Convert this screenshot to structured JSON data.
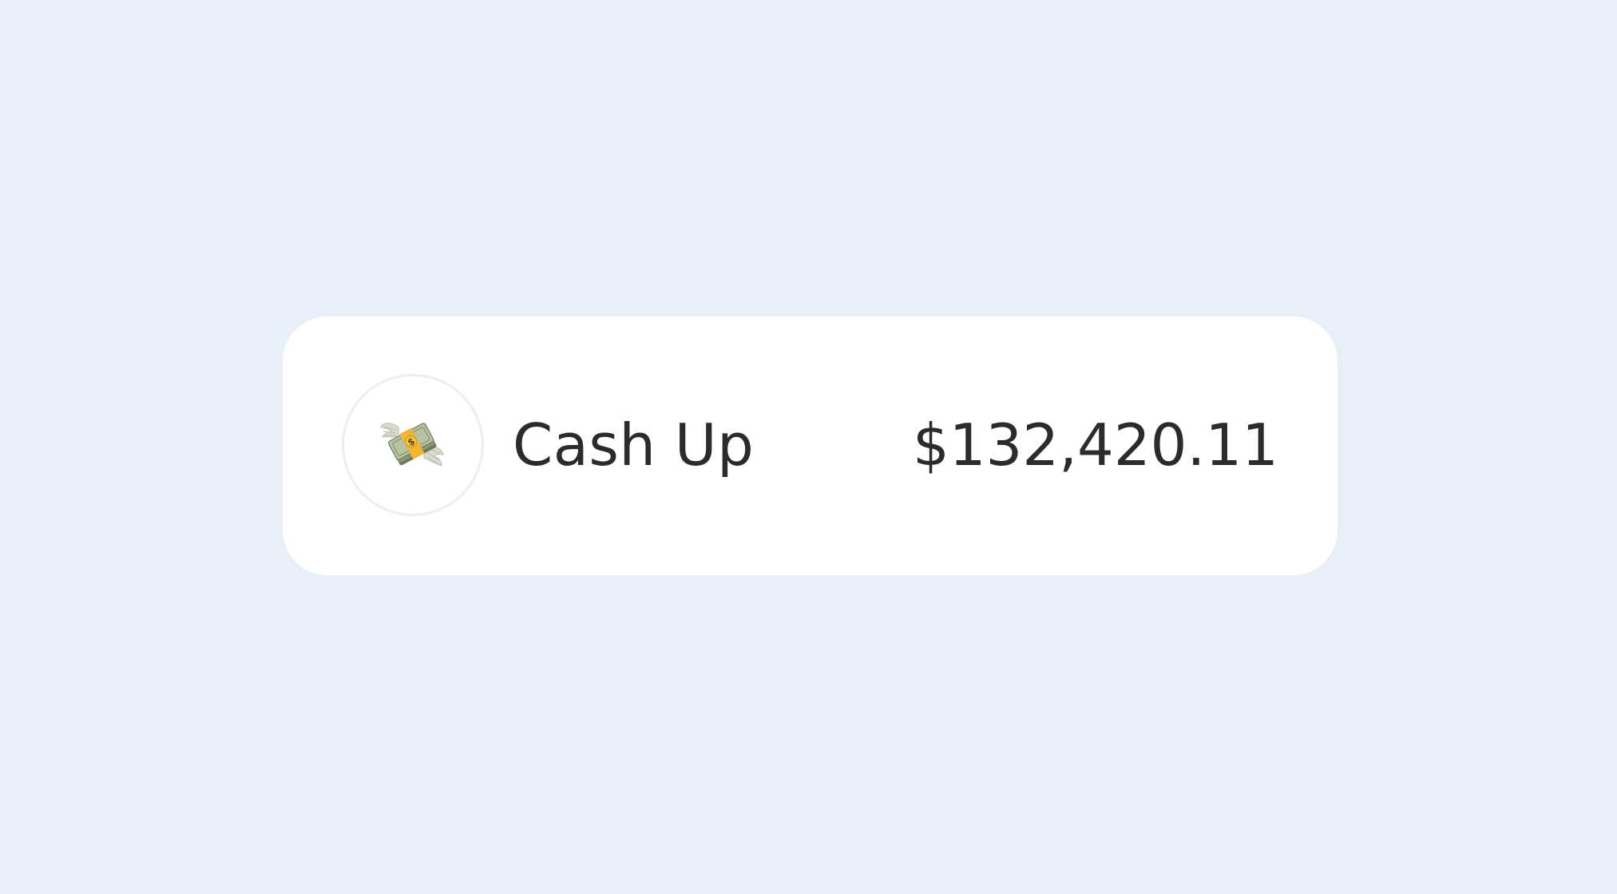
{
  "card": {
    "icon": "money-with-wings-icon",
    "label": "Cash Up",
    "amount": "$132,420.11"
  },
  "colors": {
    "background": "#e8eff9",
    "card": "#ffffff",
    "text": "#2b2b2b",
    "ring": "#eeeeee"
  }
}
